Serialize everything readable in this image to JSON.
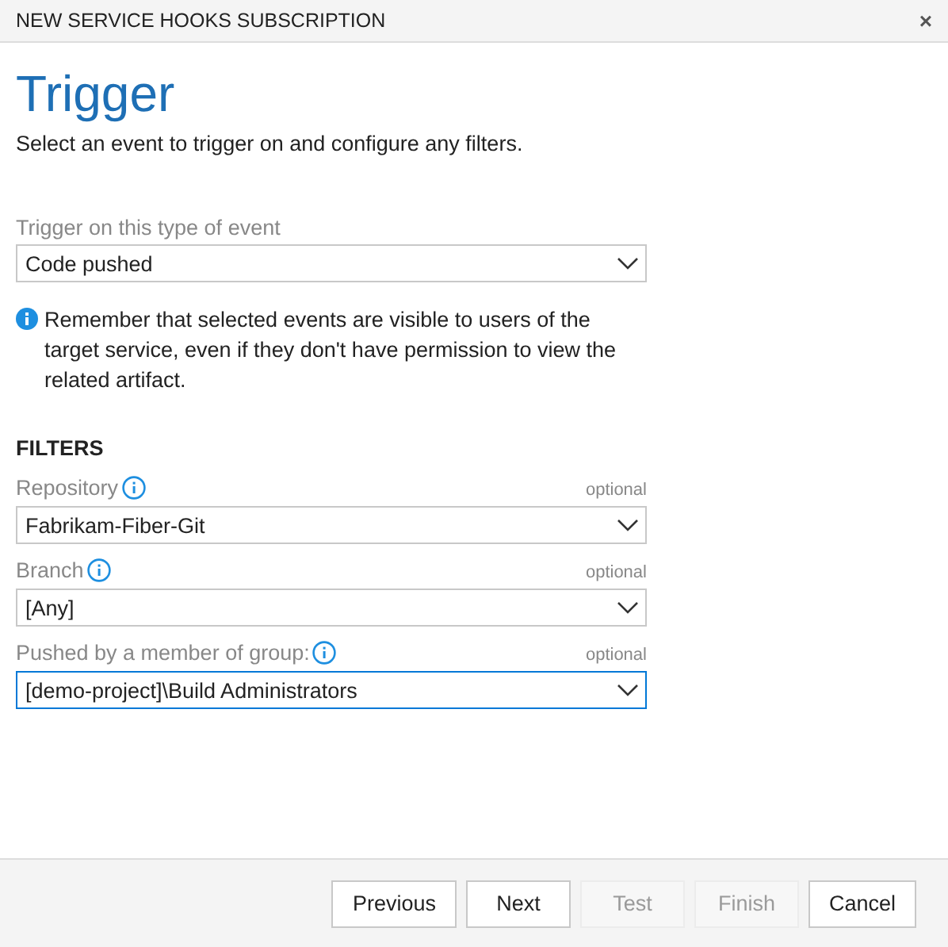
{
  "window": {
    "title": "NEW SERVICE HOOKS SUBSCRIPTION",
    "close": "×"
  },
  "heading": "Trigger",
  "subtitle": "Select an event to trigger on and configure any filters.",
  "trigger": {
    "label": "Trigger on this type of event",
    "value": "Code pushed"
  },
  "notice": "Remember that selected events are visible to users of the target service, even if they don't have permission to view the related artifact.",
  "filters": {
    "title": "FILTERS",
    "items": [
      {
        "label": "Repository",
        "hint": "optional",
        "value": "Fabrikam-Fiber-Git",
        "focused": false
      },
      {
        "label": "Branch",
        "hint": "optional",
        "value": "[Any]",
        "focused": false
      },
      {
        "label": "Pushed by a member of group:",
        "hint": "optional",
        "value": "[demo-project]\\Build Administrators",
        "focused": true
      }
    ]
  },
  "buttons": [
    {
      "label": "Previous",
      "disabled": false
    },
    {
      "label": "Next",
      "disabled": false
    },
    {
      "label": "Test",
      "disabled": true
    },
    {
      "label": "Finish",
      "disabled": true
    },
    {
      "label": "Cancel",
      "disabled": false
    }
  ]
}
